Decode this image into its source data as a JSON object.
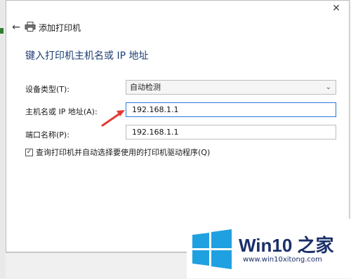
{
  "window": {
    "close_symbol": "✕",
    "back_symbol": "←",
    "header_title": "添加打印机"
  },
  "form": {
    "page_title": "键入打印机主机名或 IP 地址",
    "device_type_label": "设备类型(T):",
    "device_type_value": "自动检测",
    "hostname_label": "主机名或 IP 地址(A):",
    "hostname_value": "192.168.1.1",
    "port_name_label": "端口名称(P):",
    "port_name_value": "192.168.1.1",
    "query_checkbox_label": "查询打印机并自动选择要使用的打印机驱动程序(Q)",
    "query_checkbox_checked": true
  },
  "watermark": {
    "brand": "Win10 之家",
    "url": "www.win10xitong.com"
  },
  "icons": {
    "back": "back-arrow-icon",
    "printer": "printer-icon",
    "close": "close-icon",
    "dropdown": "chevron-down-icon",
    "annotation": "red-arrow-icon",
    "logo": "windows-logo-icon"
  },
  "colors": {
    "page_title": "#1e3f73",
    "annotation_arrow": "#e53935",
    "input_focus": "#2b79d6",
    "watermark_text": "#1b2f6b",
    "windows_blue": "#1fa0e0"
  }
}
